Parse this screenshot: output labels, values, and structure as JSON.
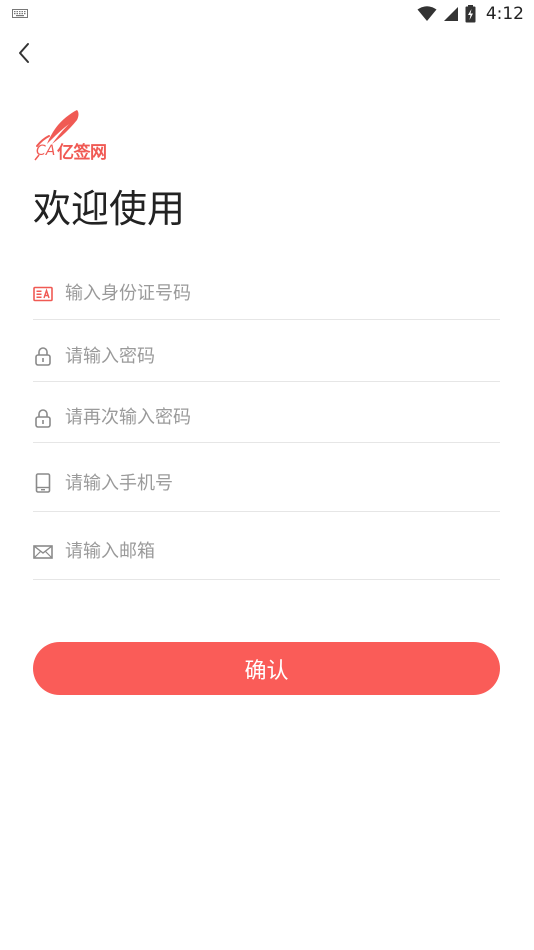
{
  "status_bar": {
    "time": "4:12"
  },
  "logo": {
    "text_ca": "CA",
    "text_brand": "亿签网"
  },
  "page": {
    "title": "欢迎使用"
  },
  "form": {
    "id_card": {
      "placeholder": "输入身份证号码",
      "value": ""
    },
    "password": {
      "placeholder": "请输入密码",
      "value": ""
    },
    "password_confirm": {
      "placeholder": "请再次输入密码",
      "value": ""
    },
    "phone": {
      "placeholder": "请输入手机号",
      "value": ""
    },
    "email": {
      "placeholder": "请输入邮箱",
      "value": ""
    }
  },
  "confirm_button": {
    "label": "确认"
  },
  "colors": {
    "accent": "#fa5c58",
    "icon_accent": "#f05a54",
    "icon_gray": "#8a8a8a"
  }
}
